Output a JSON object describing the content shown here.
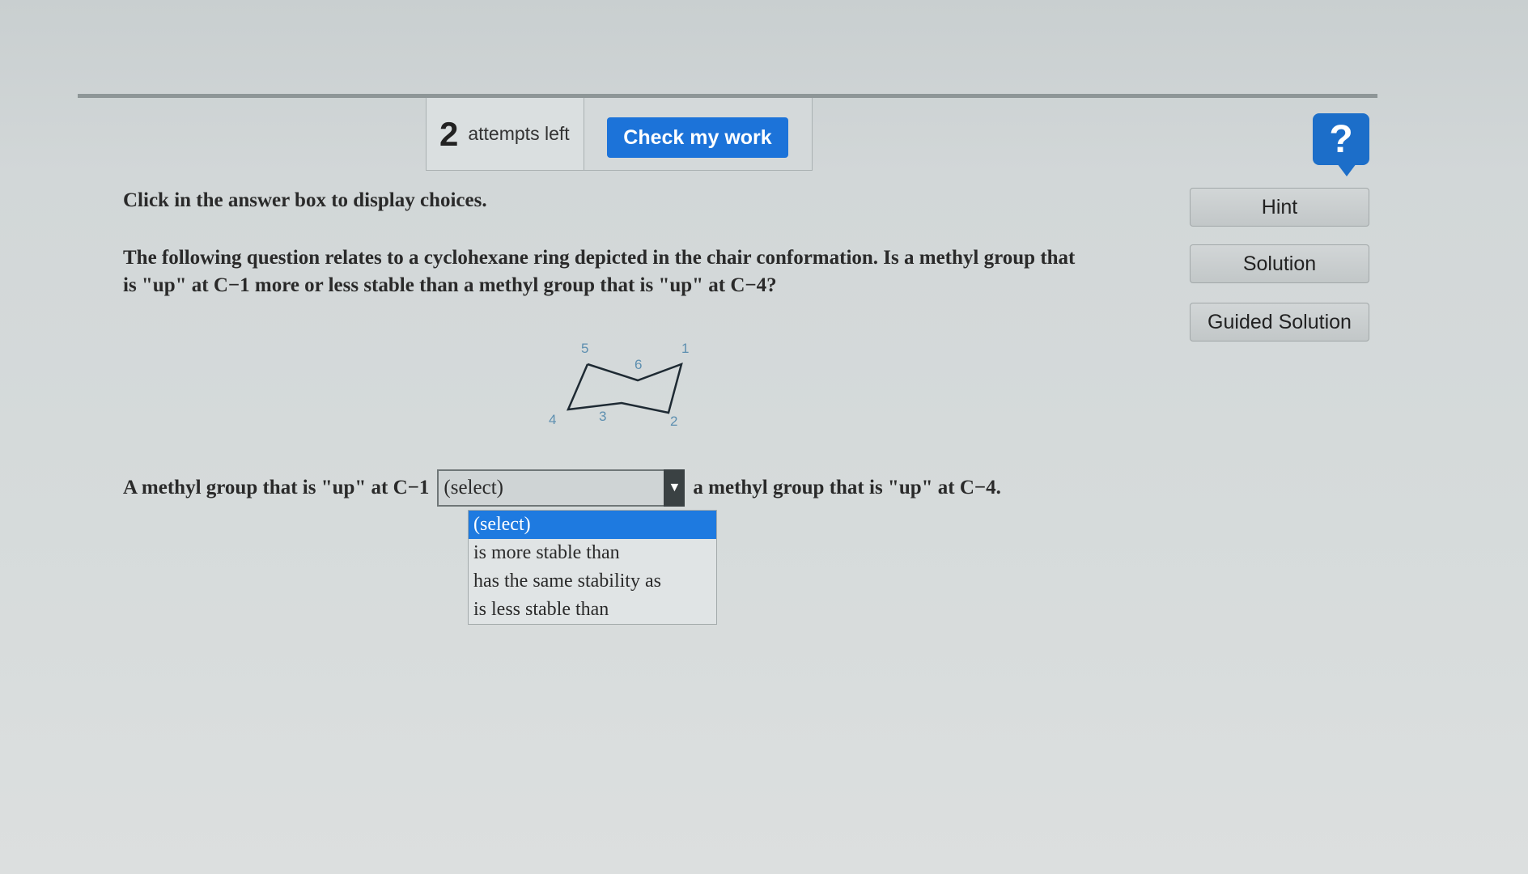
{
  "toolbar": {
    "attempts_count": "2",
    "attempts_label": "attempts left",
    "check_button": "Check my work",
    "help_icon_glyph": "?"
  },
  "side_buttons": {
    "hint": "Hint",
    "solution": "Solution",
    "guided_solution": "Guided Solution"
  },
  "content": {
    "instruction": "Click in the answer box to display choices.",
    "question": "The following question relates to a cyclohexane ring depicted in the chair conformation. Is a methyl group that is \"up\" at C−1 more or less stable than a methyl group that is \"up\" at C−4?",
    "chair_labels": {
      "c1": "1",
      "c2": "2",
      "c3": "3",
      "c4": "4",
      "c5": "5",
      "c6": "6"
    },
    "answer_prefix": "A methyl group that is \"up\" at C−1",
    "answer_suffix": "a methyl group that is \"up\" at C−4."
  },
  "select": {
    "current_value": "(select)",
    "arrow_icon": "triangle-down-icon",
    "options": [
      "(select)",
      "is more stable than",
      "has the same stability as",
      "is less stable than"
    ]
  },
  "colors": {
    "accent_blue": "#1c73d9",
    "selected_option": "#1e7ae0",
    "background": "#d4d9da"
  }
}
